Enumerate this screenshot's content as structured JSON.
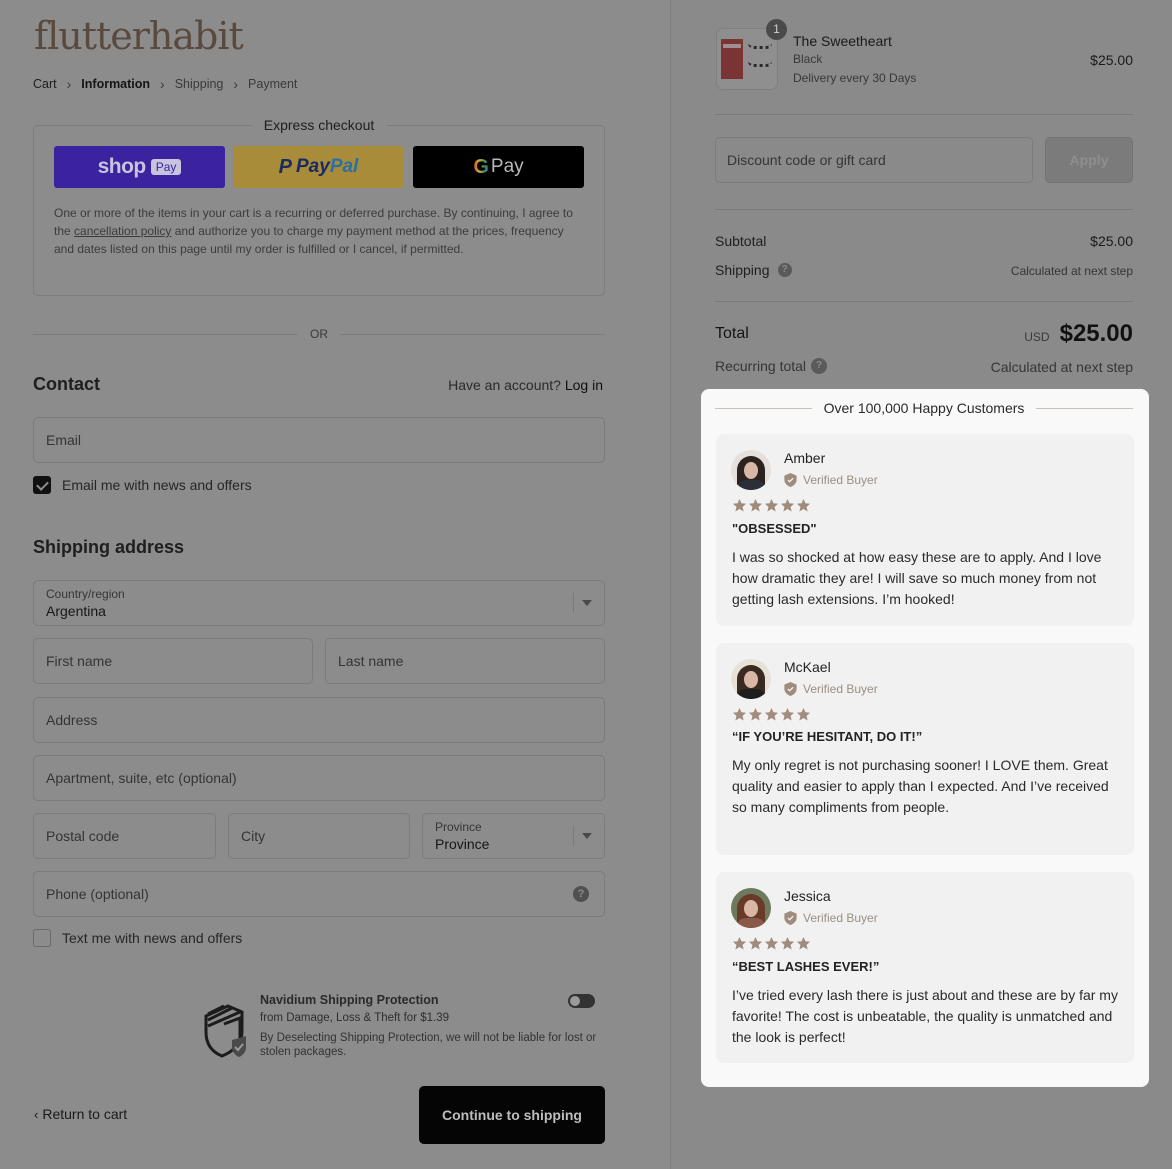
{
  "brand": {
    "logo_text": "flutterhabit"
  },
  "breadcrumb": [
    {
      "label": "Cart",
      "active": false
    },
    {
      "label": "Information",
      "active": true
    },
    {
      "label": "Shipping",
      "active": false
    },
    {
      "label": "Payment",
      "active": false
    }
  ],
  "express": {
    "title": "Express checkout",
    "shop_pay": {
      "word": "shop",
      "badge": "Pay"
    },
    "paypal": {
      "p": "P",
      "word1": "Pay",
      "word2": "Pal"
    },
    "gpay": {
      "g": "G",
      "word": "Pay"
    },
    "note_before": "One or more of the items in your cart is a recurring or deferred purchase. By continuing, I agree to the ",
    "note_link": "cancellation policy",
    "note_after": " and authorize you to charge my payment method at the prices, frequency and dates listed on this page until my order is fulfilled or I cancel, if permitted."
  },
  "or_label": "OR",
  "contact": {
    "heading": "Contact",
    "account_prompt": "Have an account?",
    "login_label": "Log in",
    "email_placeholder": "Email",
    "news_checkbox": {
      "label": "Email me with news and offers",
      "checked": true
    }
  },
  "shipping": {
    "heading": "Shipping address",
    "country": {
      "label": "Country/region",
      "value": "Argentina"
    },
    "first_name_placeholder": "First name",
    "last_name_placeholder": "Last name",
    "address_placeholder": "Address",
    "apartment_placeholder": "Apartment, suite, etc (optional)",
    "postal_placeholder": "Postal code",
    "city_placeholder": "City",
    "province": {
      "label": "Province",
      "value": "Province"
    },
    "phone_placeholder": "Phone (optional)",
    "text_checkbox": {
      "label": "Text me with news and offers",
      "checked": false
    }
  },
  "protection": {
    "title": "Navidium Shipping Protection",
    "subtitle": "from Damage, Loss & Theft for $1.39",
    "note": "By Deselecting Shipping Protection, we will not be liable for lost or stolen packages.",
    "enabled": false
  },
  "footer": {
    "return_label": "Return to cart",
    "continue_label": "Continue to shipping"
  },
  "order": {
    "item": {
      "name": "The Sweetheart",
      "variant": "Black",
      "delivery": "Delivery every 30 Days",
      "price": "$25.00",
      "quantity": "1"
    },
    "discount_placeholder": "Discount code or gift card",
    "apply_label": "Apply",
    "subtotal_label": "Subtotal",
    "subtotal_value": "$25.00",
    "shipping_label": "Shipping",
    "shipping_value": "Calculated at next step",
    "total_label": "Total",
    "total_currency": "USD",
    "total_value": "$25.00",
    "recurring_label": "Recurring total",
    "recurring_value": "Calculated at next step"
  },
  "reviews": {
    "header": "Over 100,000 Happy Customers",
    "star_color": "#a08c7e",
    "items": [
      {
        "name": "Amber",
        "badge": "Verified Buyer",
        "rating": 5,
        "title": "\"OBSESSED\"",
        "body": "I was so shocked at how easy these are to apply. And I love how dramatic they are! I will save so much money from not getting lash extensions. I’m hooked!"
      },
      {
        "name": "McKael",
        "badge": "Verified Buyer",
        "rating": 5,
        "title": "“IF YOU’RE HESITANT, DO IT!”",
        "body": "My only regret is not purchasing sooner! I LOVE them. Great quality and easier to apply than I expected. And I’ve received so many compliments from people."
      },
      {
        "name": "Jessica",
        "badge": "Verified Buyer",
        "rating": 5,
        "title": "“BEST LASHES EVER!”",
        "body": "I’ve tried every lash there is just about and these are by far my favorite! The cost is unbeatable, the quality is unmatched and the look is perfect!"
      }
    ]
  }
}
